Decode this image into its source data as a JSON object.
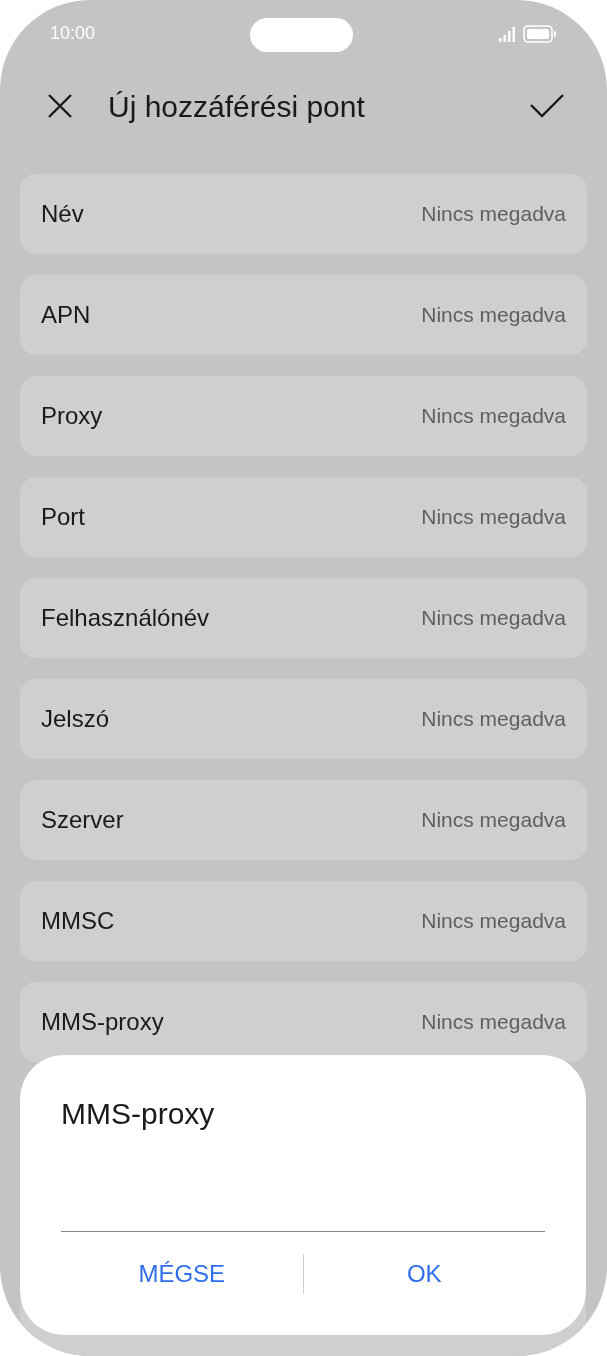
{
  "status_bar": {
    "time": "10:00"
  },
  "header": {
    "title": "Új hozzáférési pont"
  },
  "fields": [
    {
      "label": "Név",
      "value": "Nincs megadva"
    },
    {
      "label": "APN",
      "value": "Nincs megadva"
    },
    {
      "label": "Proxy",
      "value": "Nincs megadva"
    },
    {
      "label": "Port",
      "value": "Nincs megadva"
    },
    {
      "label": "Felhasználónév",
      "value": "Nincs megadva"
    },
    {
      "label": "Jelszó",
      "value": "Nincs megadva"
    },
    {
      "label": "Szerver",
      "value": "Nincs megadva"
    },
    {
      "label": "MMSC",
      "value": "Nincs megadva"
    },
    {
      "label": "MMS-proxy",
      "value": "Nincs megadva"
    }
  ],
  "dialog": {
    "title": "MMS-proxy",
    "buttons": [
      "MÉGSE",
      "OK"
    ]
  }
}
